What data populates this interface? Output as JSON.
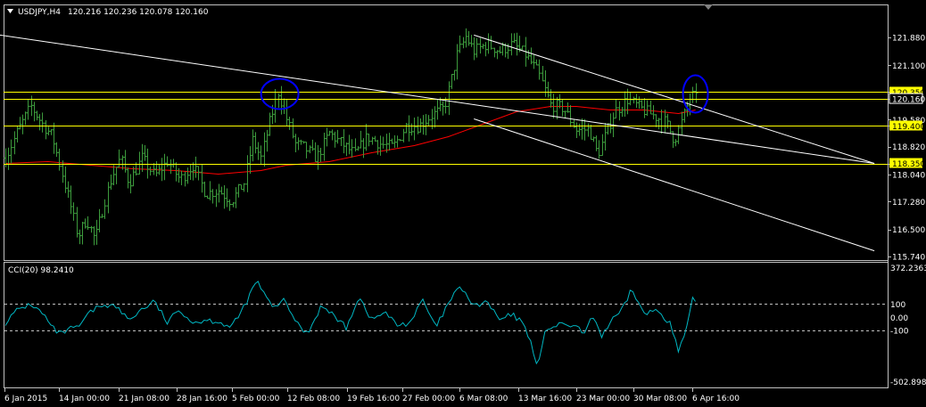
{
  "colors": {
    "background": "#000000",
    "frame": "#c0c0c0",
    "text": "#ffffff",
    "bars": "#3c9a3c",
    "ma": "#ff0000",
    "level_lines": "#ffff00",
    "level_label_bg": "#ffff00",
    "level_label_text": "#000000",
    "channel": "#ffffff",
    "circle": "#0000ff",
    "cci": "#00b7c3",
    "cci_levels": "#c0c0c0"
  },
  "header": {
    "symbol_tf": "USDJPY,H4",
    "prices": "120.216 120.236 120.078 120.160"
  },
  "price_axis_labels": [
    "121.880",
    "121.100",
    "120.350",
    "120.160",
    "119.580",
    "119.400",
    "118.820",
    "118.350",
    "118.040",
    "117.280",
    "116.500",
    "115.740"
  ],
  "time_axis_labels": [
    "6 Jan 2015",
    "14 Jan 00:00",
    "21 Jan 08:00",
    "28 Jan 16:00",
    "5 Feb 00:00",
    "12 Feb 08:00",
    "19 Feb 16:00",
    "27 Feb 00:00",
    "6 Mar 08:00",
    "13 Mar 16:00",
    "23 Mar 00:00",
    "30 Mar 08:00",
    "6 Apr 16:00"
  ],
  "indicator": {
    "label": "CCI(20) 98.2410",
    "axis_labels": [
      "372.2363",
      "100",
      "0.00",
      "-100",
      "-502.8983"
    ]
  },
  "chart_data": {
    "type": "line",
    "symbol": "USDJPY",
    "timeframe": "H4",
    "last_bar": {
      "open": 120.216,
      "high": 120.236,
      "low": 120.078,
      "close": 120.16
    },
    "price_range": [
      115.74,
      122.26
    ],
    "horizontal_levels": [
      120.35,
      120.16,
      119.4,
      118.35
    ],
    "time_labels": [
      "6 Jan 2015",
      "14 Jan 00:00",
      "21 Jan 08:00",
      "28 Jan 16:00",
      "5 Feb 00:00",
      "12 Feb 08:00",
      "19 Feb 16:00",
      "27 Feb 00:00",
      "6 Mar 08:00",
      "13 Mar 16:00",
      "23 Mar 00:00",
      "30 Mar 08:00",
      "6 Apr 16:00"
    ],
    "price_path": [
      [
        0,
        118.5
      ],
      [
        1.5,
        119.3
      ],
      [
        3,
        119.95
      ],
      [
        4.5,
        119.4
      ],
      [
        5.5,
        119.1
      ],
      [
        6.5,
        118.2
      ],
      [
        7.5,
        117.3
      ],
      [
        8.5,
        116.3
      ],
      [
        9.5,
        116.8
      ],
      [
        10.5,
        116.2
      ],
      [
        11.5,
        117.2
      ],
      [
        12.5,
        118.0
      ],
      [
        13.5,
        118.5
      ],
      [
        14.5,
        117.8
      ],
      [
        16,
        118.5
      ],
      [
        17.5,
        118.0
      ],
      [
        19,
        118.4
      ],
      [
        20.5,
        117.9
      ],
      [
        22,
        118.3
      ],
      [
        23.5,
        117.5
      ],
      [
        25,
        117.6
      ],
      [
        26.5,
        117.3
      ],
      [
        28,
        117.8
      ],
      [
        29,
        119.0
      ],
      [
        30,
        118.5
      ],
      [
        31,
        119.5
      ],
      [
        32,
        120.35
      ],
      [
        33,
        119.6
      ],
      [
        34,
        118.9
      ],
      [
        35,
        118.8
      ],
      [
        36.5,
        118.5
      ],
      [
        38,
        119.2
      ],
      [
        39.5,
        118.9
      ],
      [
        41,
        118.6
      ],
      [
        42.5,
        119.1
      ],
      [
        44,
        118.9
      ],
      [
        45.5,
        118.8
      ],
      [
        47,
        119.4
      ],
      [
        48.5,
        119.4
      ],
      [
        50,
        119.7
      ],
      [
        51.5,
        119.9
      ],
      [
        53,
        121.4
      ],
      [
        54,
        121.9
      ],
      [
        55,
        121.5
      ],
      [
        56.5,
        121.7
      ],
      [
        58,
        121.5
      ],
      [
        59.5,
        121.7
      ],
      [
        61,
        121.4
      ],
      [
        62.5,
        120.9
      ],
      [
        64,
        120.0
      ],
      [
        65.5,
        119.9
      ],
      [
        67,
        119.3
      ],
      [
        68.5,
        119.3
      ],
      [
        69.5,
        118.6
      ],
      [
        70.5,
        119.2
      ],
      [
        71.5,
        119.8
      ],
      [
        73,
        120.15
      ],
      [
        74.5,
        119.9
      ],
      [
        76,
        119.7
      ],
      [
        77.5,
        119.5
      ],
      [
        78.5,
        119.0
      ],
      [
        79.5,
        119.6
      ],
      [
        80.5,
        120.3
      ],
      [
        81,
        120.16
      ]
    ],
    "moving_average": [
      [
        0,
        118.35
      ],
      [
        5,
        118.4
      ],
      [
        10,
        118.3
      ],
      [
        15,
        118.2
      ],
      [
        20,
        118.15
      ],
      [
        25,
        118.05
      ],
      [
        30,
        118.15
      ],
      [
        33,
        118.3
      ],
      [
        38,
        118.4
      ],
      [
        43,
        118.65
      ],
      [
        48,
        118.85
      ],
      [
        52,
        119.1
      ],
      [
        56,
        119.45
      ],
      [
        60,
        119.8
      ],
      [
        64,
        119.95
      ],
      [
        67,
        119.95
      ],
      [
        71,
        119.85
      ],
      [
        75,
        119.85
      ],
      [
        79,
        119.75
      ],
      [
        81,
        119.85
      ]
    ],
    "channel_lines": [
      {
        "from": [
          -2,
          122.0
        ],
        "to": [
          102,
          118.35
        ]
      },
      {
        "from": [
          55,
          121.95
        ],
        "to": [
          102,
          118.35
        ]
      },
      {
        "from": [
          55,
          119.6
        ],
        "to": [
          102,
          115.9
        ]
      }
    ],
    "circled_highs": [
      [
        32,
        120.35
      ],
      [
        81,
        120.35
      ]
    ],
    "indicator_cci": {
      "period": 20,
      "current": 98.241,
      "range": [
        -502.8983,
        372.2363
      ],
      "levels": [
        100,
        -100
      ],
      "path": [
        [
          0,
          -40
        ],
        [
          1.5,
          60
        ],
        [
          3,
          100
        ],
        [
          4.5,
          20
        ],
        [
          5.5,
          -80
        ],
        [
          6.5,
          -130
        ],
        [
          7.5,
          -90
        ],
        [
          8.5,
          -80
        ],
        [
          10,
          40
        ],
        [
          11.5,
          100
        ],
        [
          13,
          80
        ],
        [
          14.5,
          -20
        ],
        [
          16,
          60
        ],
        [
          17.5,
          120
        ],
        [
          19,
          -40
        ],
        [
          20.5,
          60
        ],
        [
          22,
          -40
        ],
        [
          23.5,
          -20
        ],
        [
          25,
          -30
        ],
        [
          26.5,
          -80
        ],
        [
          27.5,
          20
        ],
        [
          28.5,
          140
        ],
        [
          29.5,
          280
        ],
        [
          30.5,
          160
        ],
        [
          31.5,
          60
        ],
        [
          32.5,
          140
        ],
        [
          33.5,
          40
        ],
        [
          34.5,
          -70
        ],
        [
          35.5,
          -120
        ],
        [
          37,
          80
        ],
        [
          38.5,
          20
        ],
        [
          40,
          -80
        ],
        [
          41.5,
          160
        ],
        [
          43,
          -20
        ],
        [
          44.5,
          40
        ],
        [
          46,
          -60
        ],
        [
          47.5,
          -40
        ],
        [
          49,
          130
        ],
        [
          50.5,
          -80
        ],
        [
          51.5,
          40
        ],
        [
          52.5,
          160
        ],
        [
          53.5,
          230
        ],
        [
          55,
          80
        ],
        [
          56.5,
          120
        ],
        [
          58,
          -20
        ],
        [
          59.5,
          20
        ],
        [
          61,
          -60
        ],
        [
          62,
          -260
        ],
        [
          62.5,
          -370
        ],
        [
          63.5,
          -80
        ],
        [
          65,
          -60
        ],
        [
          66.5,
          -60
        ],
        [
          68,
          -120
        ],
        [
          69,
          10
        ],
        [
          70,
          -140
        ],
        [
          71,
          -40
        ],
        [
          72.5,
          60
        ],
        [
          73.5,
          220
        ],
        [
          75,
          20
        ],
        [
          76.5,
          60
        ],
        [
          78,
          -40
        ],
        [
          79,
          -260
        ],
        [
          80,
          -80
        ],
        [
          80.7,
          150
        ],
        [
          81,
          98.2
        ]
      ]
    }
  }
}
